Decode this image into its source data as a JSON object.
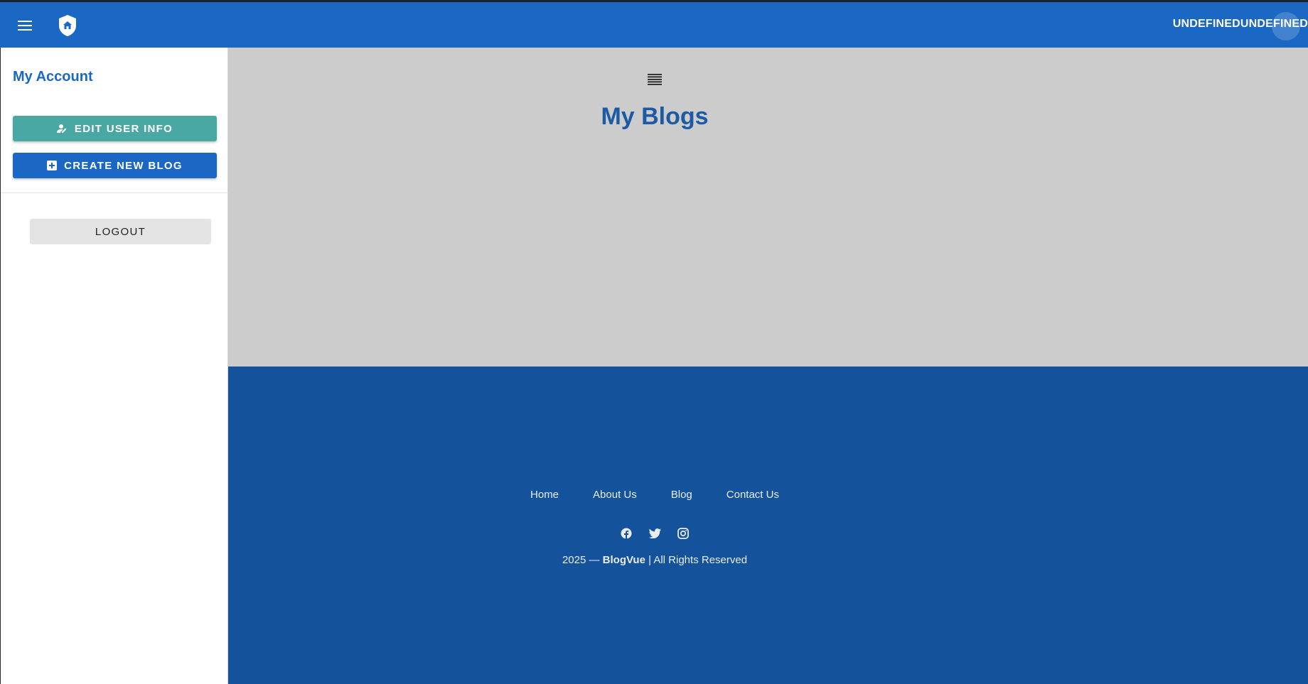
{
  "header": {
    "menu_icon": "hamburger-icon",
    "logo_icon": "shield-home-icon",
    "user_name": "UNDEFINEDUNDEFINED",
    "colors": {
      "bar": "#1a67c4"
    }
  },
  "sidebar": {
    "title": "My Account",
    "edit_label": "EDIT USER INFO",
    "edit_icon": "user-edit-icon",
    "create_label": "CREATE NEW BLOG",
    "create_icon": "plus-box-icon",
    "logout_label": "LOGOUT",
    "colors": {
      "edit": "#4aa8a4",
      "create": "#1a67c4"
    }
  },
  "main": {
    "list_icon": "list-icon",
    "title": "My Blogs"
  },
  "footer": {
    "links": [
      "Home",
      "About Us",
      "Blog",
      "Contact Us"
    ],
    "social_icons": [
      "facebook-icon",
      "twitter-icon",
      "instagram-icon"
    ],
    "copyright_prefix": "2025 — ",
    "brand": "BlogVue",
    "copyright_suffix": " | All Rights Reserved",
    "colors": {
      "background": "#14529b"
    }
  }
}
